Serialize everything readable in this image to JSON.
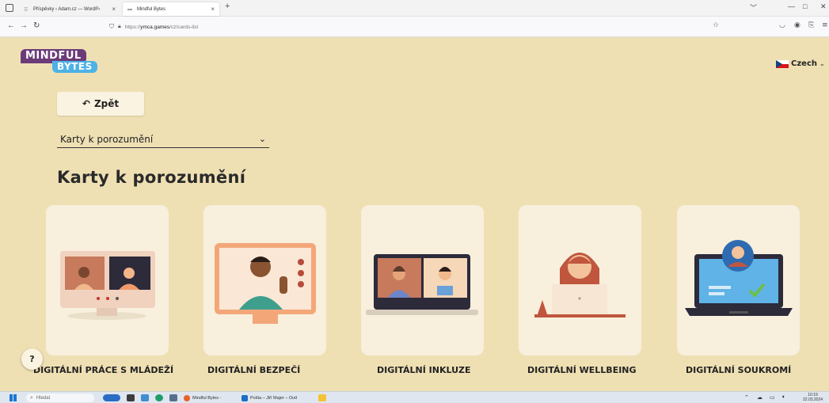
{
  "browser": {
    "tabs": [
      {
        "label": "Příspěvky ‹ Adam.cz — WordP‹",
        "close": "×"
      },
      {
        "label": "Mindful Bytes",
        "close": "×"
      }
    ],
    "new_tab": "+",
    "window_controls": [
      "﹀",
      "—",
      "□",
      "✕"
    ],
    "url_prefix": "https://",
    "url_host": "ymca.games",
    "url_path": "/cz/cards-list"
  },
  "page": {
    "logo": {
      "line1": "MINDFUL",
      "line2": "BYTES"
    },
    "language": "Czech",
    "back_button": "Zpět",
    "select_value": "Karty k porozumění",
    "heading": "Karty k porozumění",
    "help": "?",
    "cards": [
      {
        "label": "DIGITÁLNÍ PRÁCE S MLÁDEŽÍ",
        "icon": "video-call-monitor"
      },
      {
        "label": "DIGITÁLNÍ BEZPEČÍ",
        "icon": "waving-person-monitor"
      },
      {
        "label": "DIGITÁLNÍ INKLUZE",
        "icon": "laptop-video-call"
      },
      {
        "label": "DIGITÁLNÍ WELLBEING",
        "icon": "woman-with-laptop"
      },
      {
        "label": "DIGITÁLNÍ SOUKROMÍ",
        "icon": "laptop-user-check"
      }
    ]
  },
  "taskbar": {
    "search": "Hledat",
    "apps": [
      "Mindful Bytes -",
      "Pošta – Jiří Majer – Outl"
    ],
    "time": "10:19",
    "date": "22.03.2024"
  },
  "colors": {
    "page_bg": "#efe0b4",
    "card_bg": "#f8efdd",
    "logo_purple": "#6b3b79",
    "logo_blue": "#4db2e6"
  }
}
